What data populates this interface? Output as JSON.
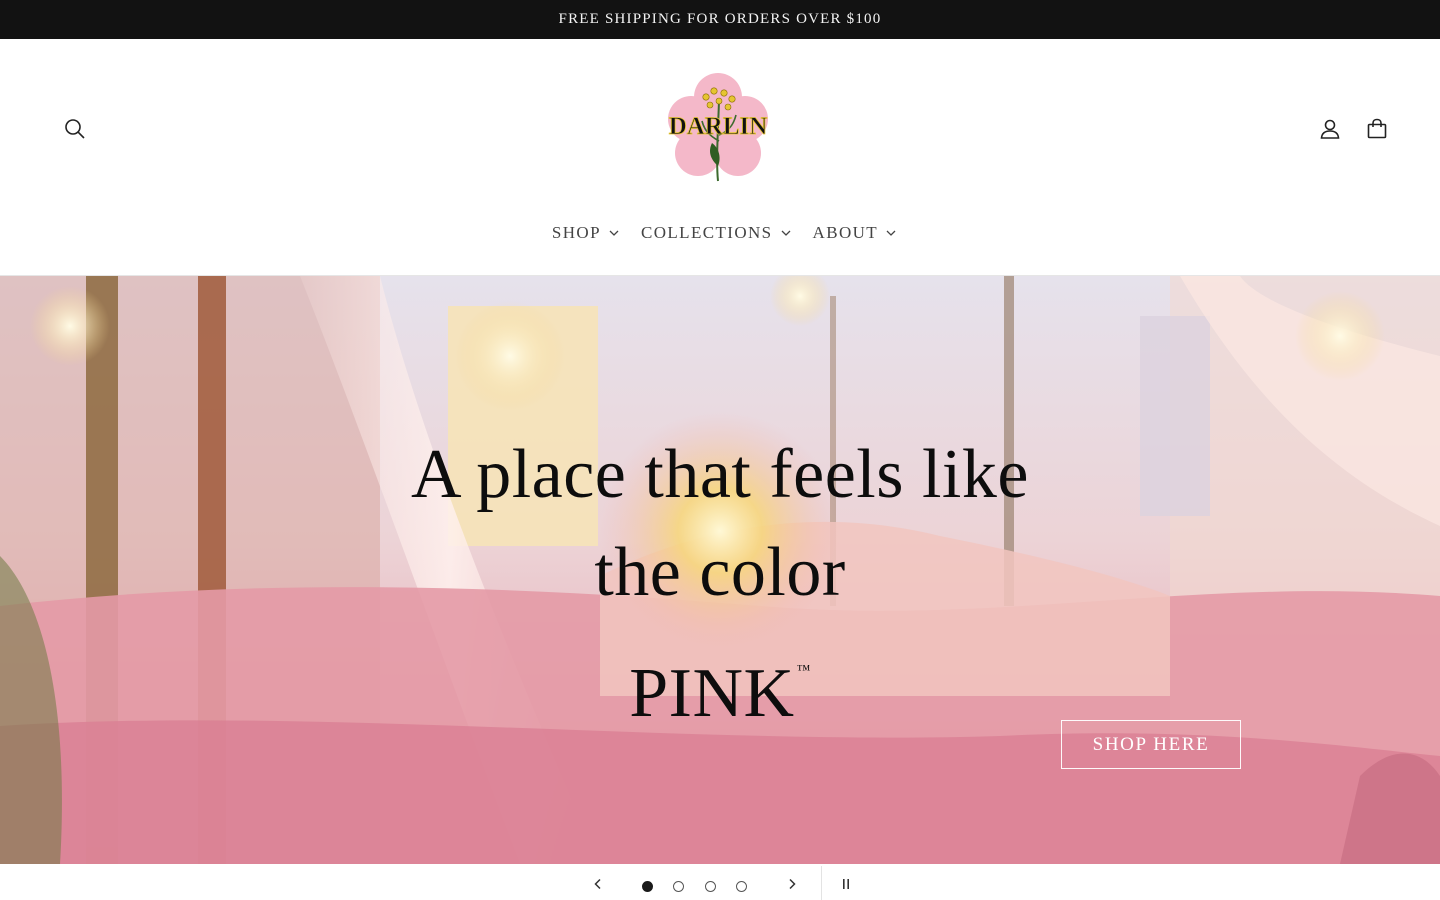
{
  "announcement": {
    "text": "FREE SHIPPING FOR ORDERS OVER $100"
  },
  "header": {
    "logo_text": "DARLIN",
    "nav": [
      {
        "label": "SHOP"
      },
      {
        "label": "COLLECTIONS"
      },
      {
        "label": "ABOUT"
      }
    ],
    "icons": [
      "search-icon",
      "account-icon",
      "cart-icon"
    ]
  },
  "hero": {
    "line1": "A place that feels like",
    "line2": "the color",
    "line3": "PINK",
    "trademark": "™",
    "button_label": "SHOP HERE"
  },
  "slider": {
    "slide_count": 4,
    "active_slide": 1
  },
  "colors": {
    "announcement_bg": "#121212",
    "logo_pink": "#f4b8c9",
    "hero_pink": "#e9a3ad"
  }
}
